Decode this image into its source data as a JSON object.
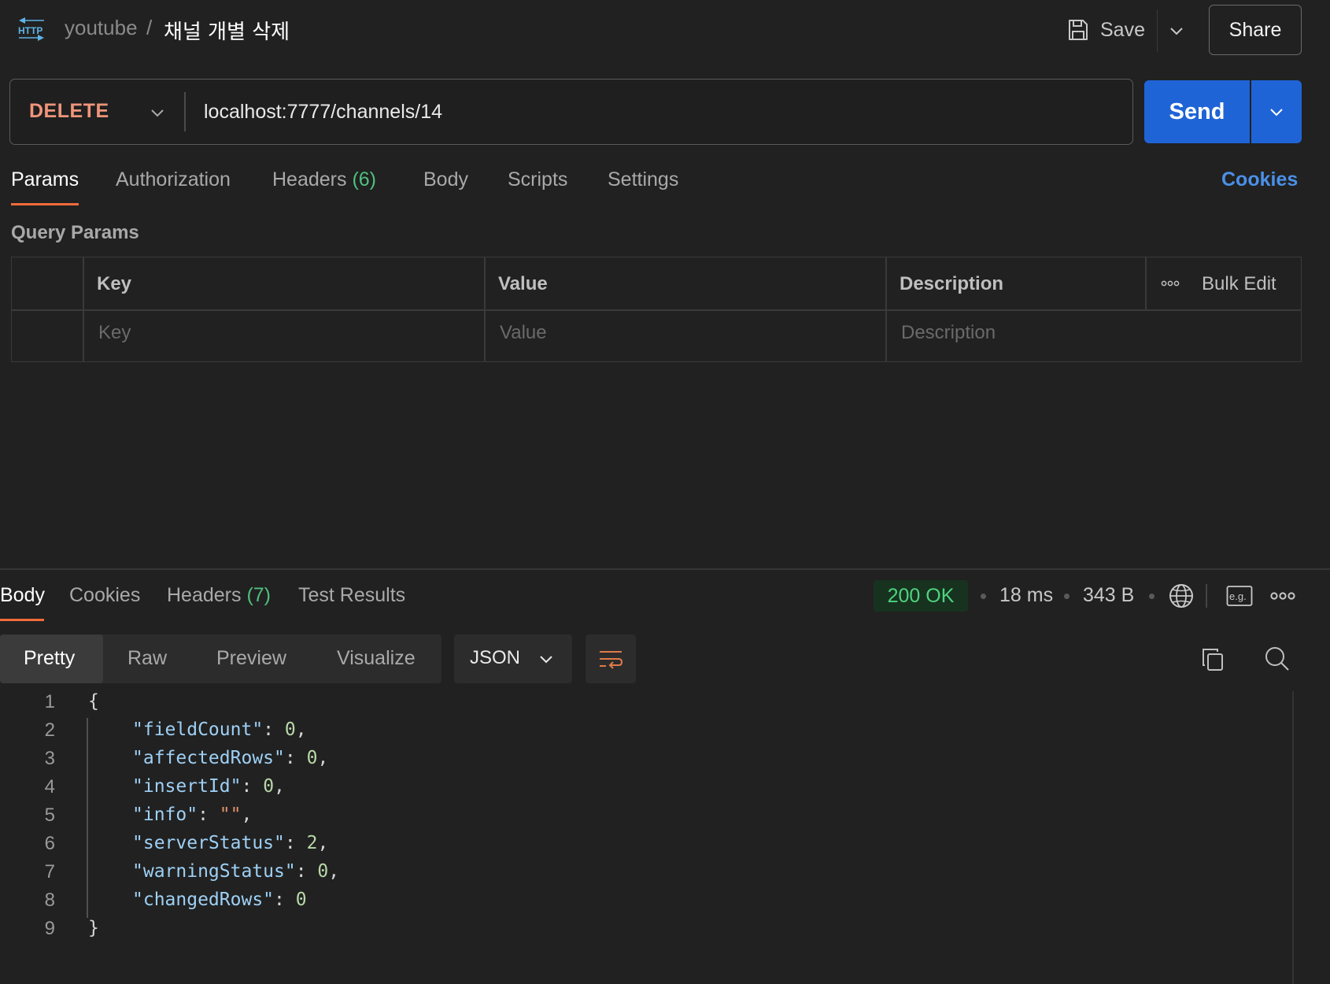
{
  "header": {
    "http_icon_label": "HTTP",
    "collection": "youtube",
    "separator": "/",
    "request_name": "채널 개별 삭제",
    "save_label": "Save",
    "share_label": "Share"
  },
  "request": {
    "method": "DELETE",
    "method_color": "#f0957b",
    "url": "localhost:7777/channels/14",
    "send_label": "Send",
    "send_color": "#1f64d6"
  },
  "request_tabs": {
    "params": "Params",
    "authorization": "Authorization",
    "headers": "Headers",
    "headers_count": "(6)",
    "body": "Body",
    "scripts": "Scripts",
    "settings": "Settings",
    "cookies": "Cookies",
    "active": "Params"
  },
  "query_params": {
    "title": "Query Params",
    "columns": {
      "key": "Key",
      "value": "Value",
      "description": "Description"
    },
    "bulk_edit": "Bulk Edit",
    "placeholders": {
      "key": "Key",
      "value": "Value",
      "description": "Description"
    }
  },
  "response_tabs": {
    "body": "Body",
    "cookies": "Cookies",
    "headers": "Headers",
    "headers_count": "(7)",
    "test_results": "Test Results",
    "active": "Body"
  },
  "response_meta": {
    "status": "200 OK",
    "status_color": "#4fd37f",
    "time": "18 ms",
    "size": "343 B",
    "example_icon_label": "e.g."
  },
  "format_bar": {
    "pretty": "Pretty",
    "raw": "Raw",
    "preview": "Preview",
    "visualize": "Visualize",
    "active": "Pretty",
    "language": "JSON"
  },
  "code_lines": [
    {
      "n": "1"
    },
    {
      "n": "2",
      "key": "\"fieldCount\"",
      "sep": ": ",
      "val": "0",
      "end": ","
    },
    {
      "n": "3",
      "key": "\"affectedRows\"",
      "sep": ": ",
      "val": "0",
      "end": ","
    },
    {
      "n": "4",
      "key": "\"insertId\"",
      "sep": ": ",
      "val": "0",
      "end": ","
    },
    {
      "n": "5",
      "key": "\"info\"",
      "sep": ": ",
      "val": "\"\"",
      "end": ","
    },
    {
      "n": "6",
      "key": "\"serverStatus\"",
      "sep": ": ",
      "val": "2",
      "end": ","
    },
    {
      "n": "7",
      "key": "\"warningStatus\"",
      "sep": ": ",
      "val": "0",
      "end": ","
    },
    {
      "n": "8",
      "key": "\"changedRows\"",
      "sep": ": ",
      "val": "0",
      "end": ""
    },
    {
      "n": "9"
    }
  ],
  "code_braces": {
    "open": "{",
    "close": "}"
  }
}
